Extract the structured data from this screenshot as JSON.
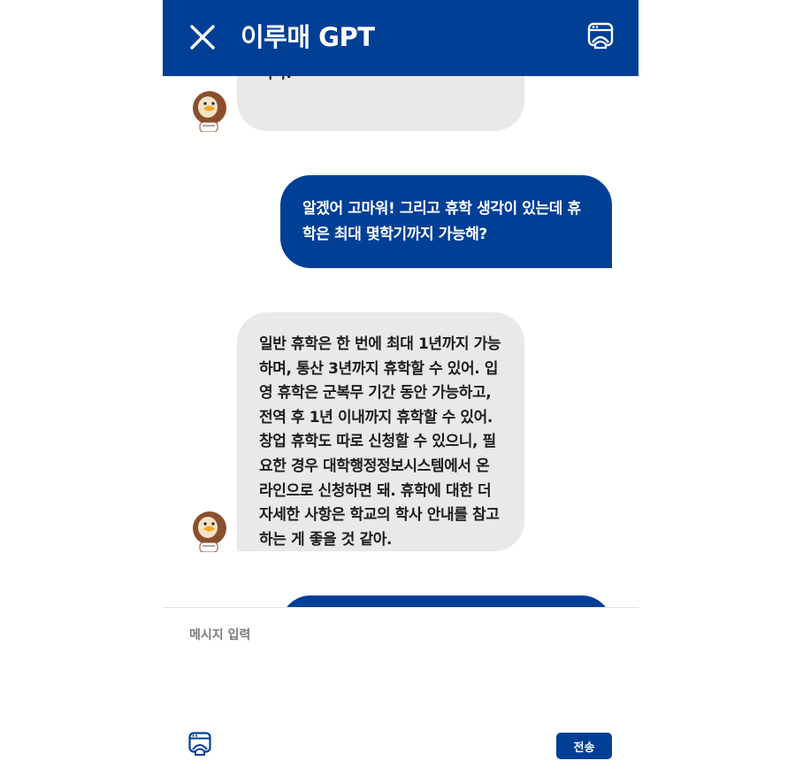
{
  "header": {
    "title": "이루매 GPT",
    "close_icon": "close-icon",
    "menu_icon": "chat-bot-icon"
  },
  "messages": [
    {
      "role": "bot",
      "text": "니다.",
      "partial": true
    },
    {
      "role": "user",
      "text": "알겠어 고마워! 그리고 휴학 생각이 있는데 휴학은 최대 몇학기까지 가능해?"
    },
    {
      "role": "bot",
      "text": "일반 휴학은 한 번에 최대 1년까지 가능하며, 통산 3년까지 휴학할 수 있어. 입영 휴학은 군복무 기간 동안 가능하고, 전역 후 1년 이내까지 휴학할 수 있어. 창업 휴학도 따로 신청할 수 있으니, 필요한 경우 대학행정정보시스템에서 온라인으로 신청하면 돼. 휴학에 대한 더 자세한 사항은 학교의 학사 안내를 참고하는 게 좋을 것 같아."
    }
  ],
  "input": {
    "placeholder": "메시지 입력",
    "value": ""
  },
  "footer": {
    "send_label": "전송",
    "attach_icon": "chat-bot-icon"
  },
  "colors": {
    "primary": "#003f96",
    "bot_bubble": "#e9e9e9",
    "text": "#1d1d1d",
    "placeholder": "#7a7a7a"
  }
}
